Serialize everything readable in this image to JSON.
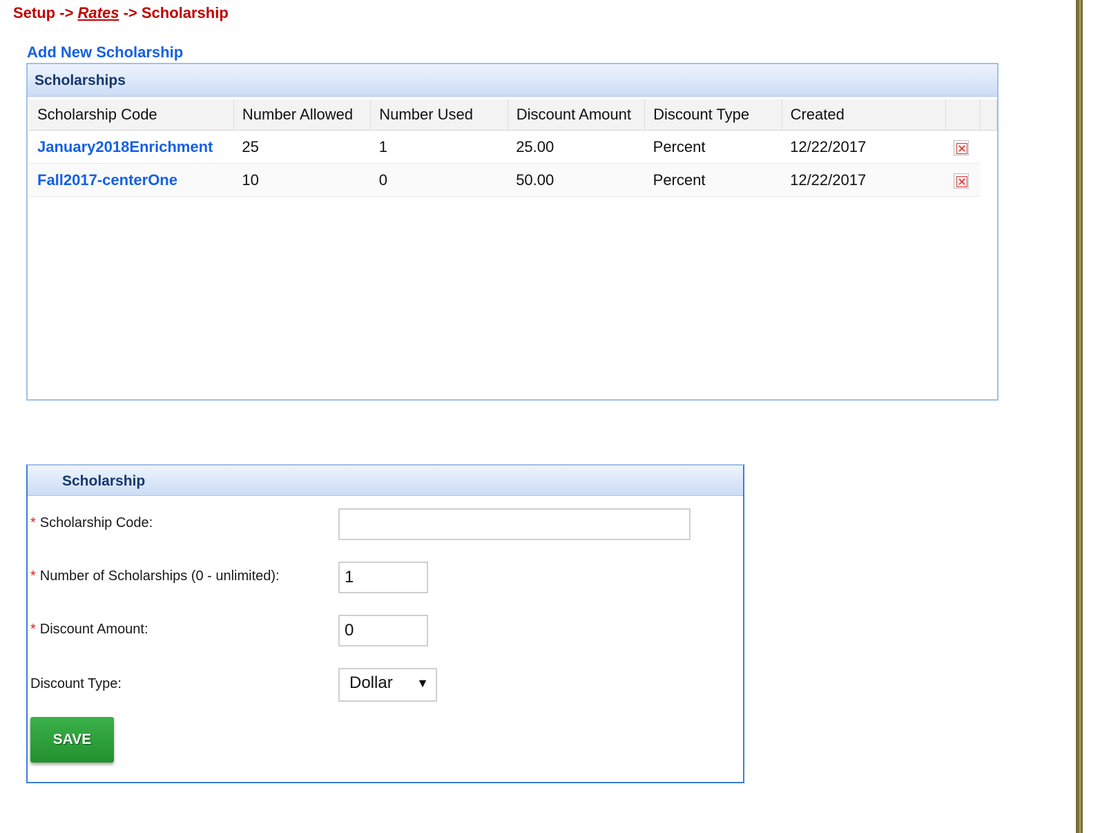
{
  "breadcrumb": {
    "root": "Setup",
    "sep1": " -> ",
    "middle": "Rates",
    "sep2": " -> ",
    "current": "Scholarship"
  },
  "add_link": "Add New Scholarship",
  "list_panel": {
    "title": "Scholarships",
    "columns": [
      "Scholarship Code",
      "Number Allowed",
      "Number Used",
      "Discount Amount",
      "Discount Type",
      "Created"
    ],
    "rows": [
      {
        "code": "January2018Enrichment",
        "allowed": "25",
        "used": "1",
        "amount": "25.00",
        "type": "Percent",
        "created": "12/22/2017",
        "delete_icon": "delete-icon"
      },
      {
        "code": "Fall2017-centerOne",
        "allowed": "10",
        "used": "0",
        "amount": "50.00",
        "type": "Percent",
        "created": "12/22/2017",
        "delete_icon": "delete-icon"
      }
    ]
  },
  "form": {
    "title": "Scholarship",
    "required_mark": "*",
    "code_label": "Scholarship Code:",
    "code_value": "",
    "count_label": "Number of Scholarships (0 - unlimited):",
    "count_value": "1",
    "amount_label": "Discount Amount:",
    "amount_value": "0",
    "type_label": "Discount Type:",
    "type_selected": "Dollar",
    "save_label": "SAVE"
  },
  "colors": {
    "breadcrumb": "#c00000",
    "link": "#1460e6",
    "panel_border": "#9ec0ea",
    "save_button": "#2ea03c",
    "delete": "#d23b3b"
  }
}
